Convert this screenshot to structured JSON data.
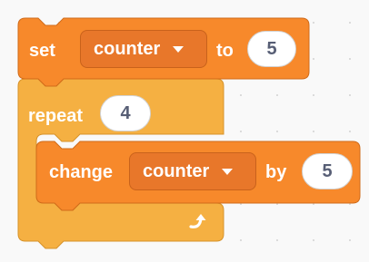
{
  "blocks": {
    "set": {
      "keyword": "set",
      "variable": "counter",
      "connector": "to",
      "value": "5"
    },
    "repeat": {
      "keyword": "repeat",
      "times": "4"
    },
    "change": {
      "keyword": "change",
      "variable": "counter",
      "connector": "by",
      "value": "5"
    }
  },
  "colors": {
    "variables_block": "#f7892b",
    "variables_block_border": "#d06b19",
    "control_block": "#f5b042",
    "control_block_border": "#d6922a",
    "canvas_background": "#f9f9f9",
    "number_text": "#575e75"
  },
  "icons": {
    "loop_arrow": "loop-arrow-icon",
    "dropdown_caret": "dropdown-caret-icon"
  }
}
